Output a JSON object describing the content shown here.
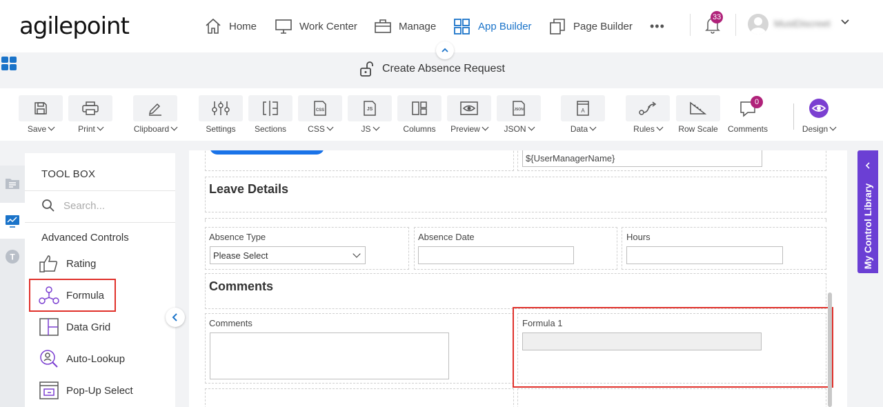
{
  "brand": {
    "logo_text": "agilepoint",
    "accent": "#1a73c9",
    "highlight": "#e0302a",
    "library_tab_color": "#6b3fd4"
  },
  "nav": {
    "home": "Home",
    "work_center": "Work Center",
    "manage": "Manage",
    "app_builder": "App Builder",
    "page_builder": "Page Builder",
    "more": "•••",
    "notifications_count": "33",
    "user_name": "MustDiscreet"
  },
  "form": {
    "title": "Create Absence Request"
  },
  "ribbon": {
    "save": "Save",
    "print": "Print",
    "clipboard": "Clipboard",
    "settings": "Settings",
    "sections": "Sections",
    "css": "CSS",
    "js": "JS",
    "columns": "Columns",
    "preview": "Preview",
    "json": "JSON",
    "data": "Data",
    "rules": "Rules",
    "row_scale": "Row Scale",
    "comments": "Comments",
    "comments_count": "0",
    "design": "Design"
  },
  "toolbox": {
    "title": "TOOL BOX",
    "search_placeholder": "Search...",
    "section": "Advanced Controls",
    "items": [
      "Rating",
      "Formula",
      "Data Grid",
      "Auto-Lookup",
      "Pop-Up Select"
    ]
  },
  "canvas": {
    "manager_value": "${UserManagerName}",
    "leave_details": "Leave Details",
    "absence_type": "Absence Type",
    "absence_type_value": "Please Select",
    "absence_date": "Absence Date",
    "hours": "Hours",
    "comments_heading": "Comments",
    "comments_label": "Comments",
    "formula_label": "Formula 1"
  },
  "control_library": {
    "label": "My Control Library"
  }
}
